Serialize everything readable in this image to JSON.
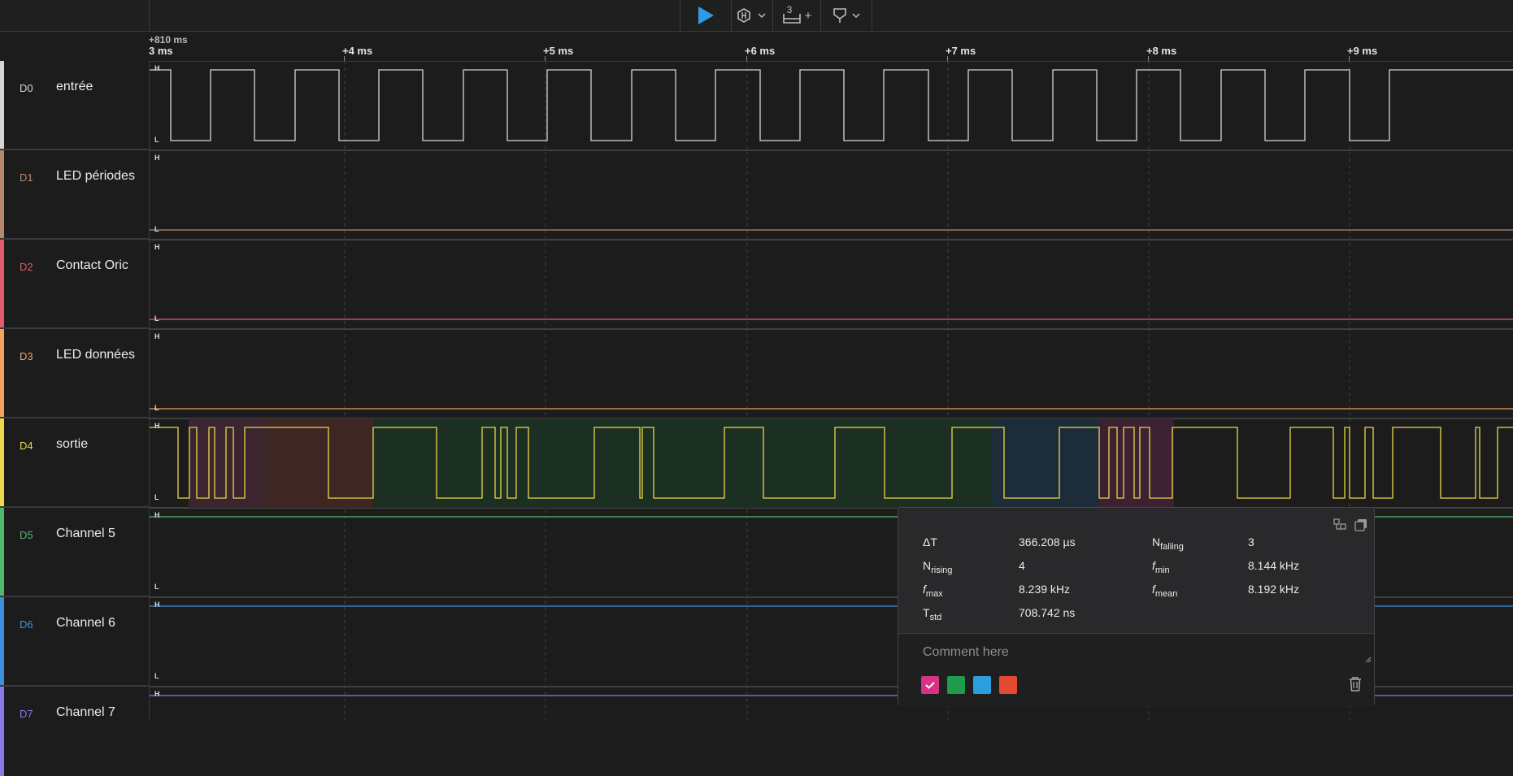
{
  "toolbar": {
    "play_icon": "play-icon",
    "trigger_icon": "trigger-icon",
    "measure_count": "3",
    "measure_add": "+",
    "marker_icon": "marker-icon"
  },
  "ruler": {
    "offset_label": "+810 ms",
    "ticks": [
      "3 ms",
      "+4 ms",
      "+5 ms",
      "+6 ms",
      "+7 ms",
      "+8 ms",
      "+9 ms"
    ]
  },
  "channels": [
    {
      "id": "D0",
      "name": "entrée",
      "color": "#d5d5d5"
    },
    {
      "id": "D1",
      "name": "LED périodes",
      "color": "#b5876c"
    },
    {
      "id": "D2",
      "name": "Contact Oric",
      "color": "#e25c6e"
    },
    {
      "id": "D3",
      "name": "LED données",
      "color": "#f0a25e"
    },
    {
      "id": "D4",
      "name": "sortie",
      "color": "#ecd84a"
    },
    {
      "id": "D5",
      "name": "Channel 5",
      "color": "#4fb96a"
    },
    {
      "id": "D6",
      "name": "Channel 6",
      "color": "#3d8fe0"
    },
    {
      "id": "D7",
      "name": "Channel 7",
      "color": "#8a78e6"
    }
  ],
  "level_labels": {
    "high": "H",
    "low": "L"
  },
  "measurement": {
    "dt_label": "ΔT",
    "dt_value": "366.208 µs",
    "nfall_label": "N",
    "nfall_sub": "falling",
    "nfall_value": "3",
    "nrise_label": "N",
    "nrise_sub": "rising",
    "nrise_value": "4",
    "fmin_label": "f",
    "fmin_sub": "min",
    "fmin_value": "8.144 kHz",
    "fmax_label": "f",
    "fmax_sub": "max",
    "fmax_value": "8.239 kHz",
    "fmean_label": "f",
    "fmean_sub": "mean",
    "fmean_value": "8.192 kHz",
    "tstd_label": "T",
    "tstd_sub": "std",
    "tstd_value": "708.742 ns",
    "comment_placeholder": "Comment here",
    "swatch_colors": [
      "#d63384",
      "#1e9c4b",
      "#2b9fdc",
      "#e34a33"
    ],
    "selected_swatch": 0
  }
}
